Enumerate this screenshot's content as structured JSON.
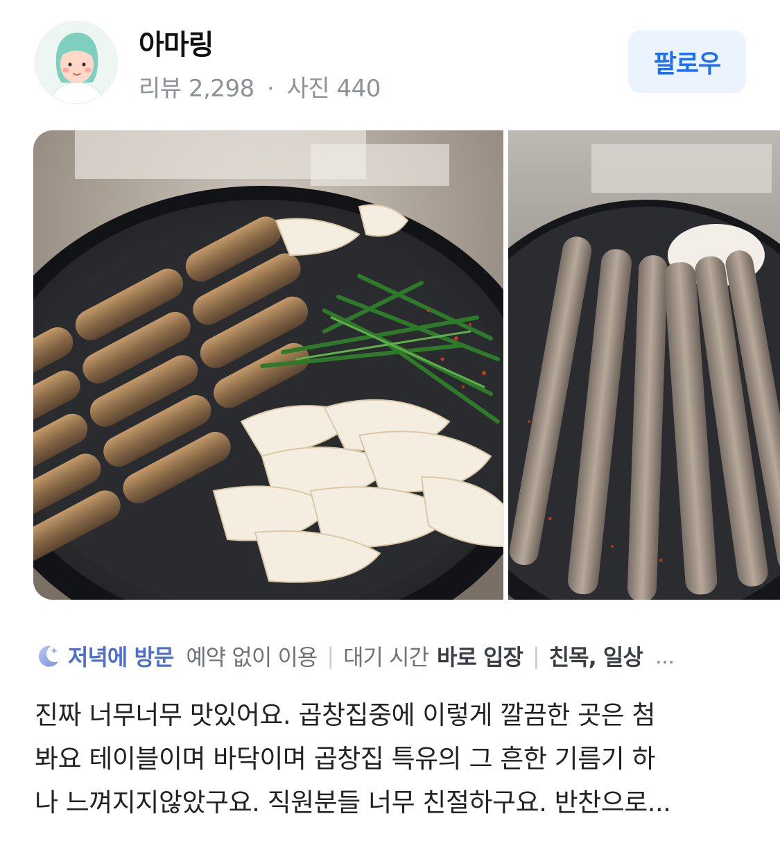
{
  "header": {
    "user_name": "아마링",
    "review_label": "리뷰",
    "review_count": "2,298",
    "separator": "·",
    "photo_label": "사진",
    "photo_count": "440",
    "follow_label": "팔로우"
  },
  "photos": [
    {
      "name": "grilled-gopchang-with-onion-and-chives",
      "icon": "food-photo"
    },
    {
      "name": "grilled-gopchang-strips",
      "icon": "food-photo"
    }
  ],
  "tags": {
    "visit_time": "저녁에 방문",
    "reservation": "예약 없이 이용",
    "wait_label": "대기 시간",
    "wait_value": "바로 입장",
    "purpose": "친목, 일상",
    "more": "...",
    "separator": "|",
    "icon": "moon-icon"
  },
  "review": {
    "lines": [
      "진짜 너무너무 맛있어요. 곱창집중에 이렇게 깔끔한 곳은 첨",
      "봐요 테이블이며 바닥이며 곱창집 특유의 그 흔한 기름기 하",
      "나 느껴지지않았구요. 직원분들 너무 친절하구요. 반찬으로..."
    ]
  },
  "colors": {
    "accent": "#1f6ff2",
    "follow_bg": "#eaf3fe",
    "visit_tag": "#4e6fce",
    "muted_text": "#8d9299"
  }
}
